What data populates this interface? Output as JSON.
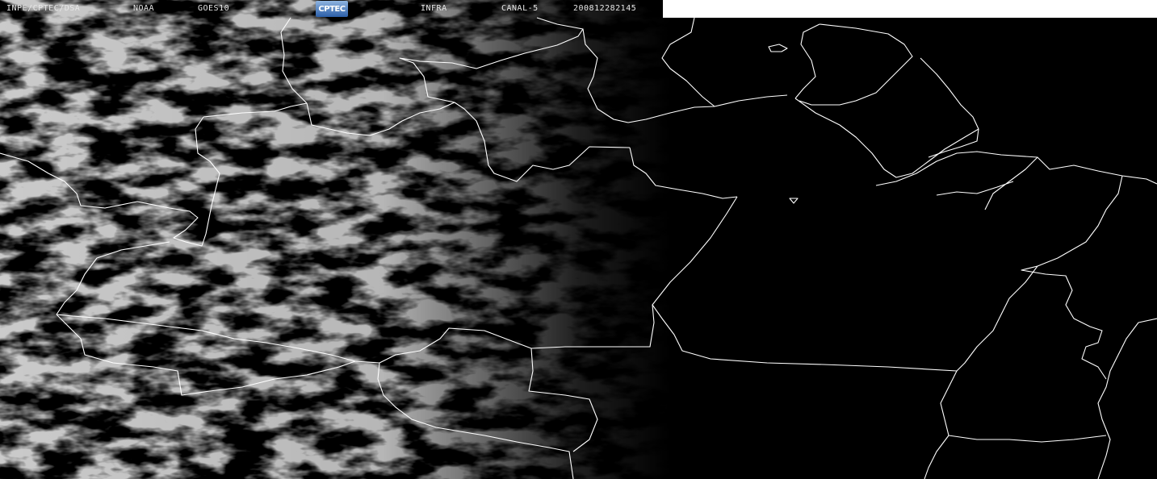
{
  "header": {
    "organization": "INPE/CPTEC/DSA",
    "agency": "NOAA",
    "satellite": "GOES10",
    "band": "INFRA",
    "channel": "CANAL-5",
    "timestamp": "200812282145",
    "logo": "CPTEC"
  },
  "colors": {
    "background": "#000000",
    "borders": "#ffffff",
    "cloud": "#9a9a9a",
    "header_text": "#e6e6e6",
    "logo_gradient_top": "#8fb4e0",
    "logo_gradient_bottom": "#2c5fa8",
    "blank_strip": "#ffffff"
  }
}
